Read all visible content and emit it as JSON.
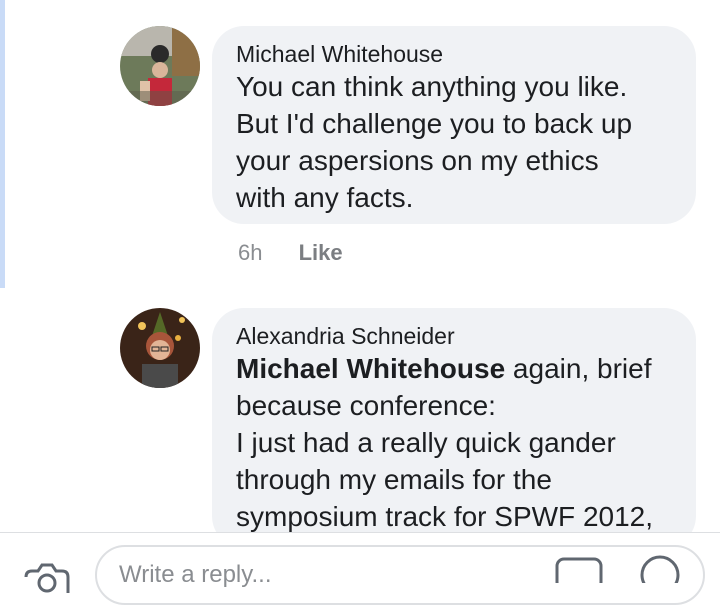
{
  "comments": [
    {
      "author": "Michael Whitehouse",
      "lines": [
        "You can think anything you like.",
        "But I'd challenge you to back up",
        "your aspersions on my ethics",
        "with any facts."
      ],
      "time": "6h",
      "like_label": "Like"
    },
    {
      "author": "Alexandria Schneider",
      "mention": "Michael Whitehouse",
      "first_line_rest": " again, brief",
      "lines": [
        "because conference:",
        "I just had a really quick gander",
        "through my emails for the",
        "symposium track for SPWF 2012,"
      ]
    }
  ],
  "composer": {
    "placeholder": "Write a reply..."
  },
  "icons": {
    "camera": "camera-icon",
    "gif": "gif-icon",
    "emoji": "emoji-icon"
  },
  "colors": {
    "bubble": "#f0f2f5",
    "thread_bar": "#c9dbf7",
    "meta": "#8a8d91"
  }
}
